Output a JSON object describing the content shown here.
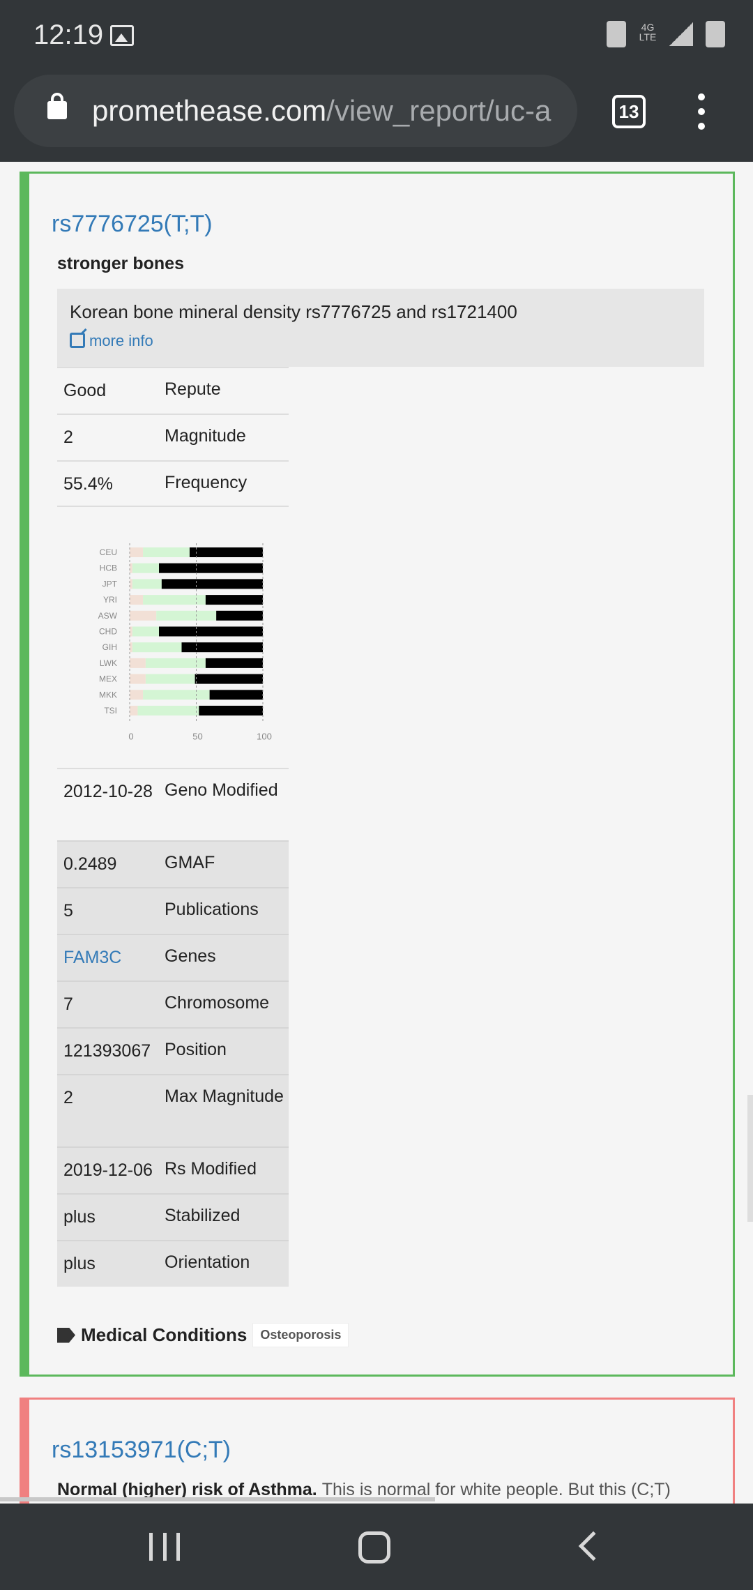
{
  "status_bar": {
    "time": "12:19",
    "network": "4G LTE"
  },
  "browser": {
    "url_host": "promethease.com",
    "url_path": "/view_report/uc-a",
    "tab_count": "13"
  },
  "card1": {
    "title": "rs7776725(T;T)",
    "summary": "stronger bones",
    "description": "Korean bone mineral density rs7776725 and rs1721400",
    "more_info": "more info",
    "facts_top": [
      {
        "value": "Good",
        "key": "Repute"
      },
      {
        "value": "2",
        "key": "Magnitude"
      },
      {
        "value": "55.4%",
        "key": "Frequency"
      }
    ],
    "facts_bottom": [
      {
        "value": "2012-10-28",
        "key": "Geno Modified"
      },
      {
        "value": "0.2489",
        "key": "GMAF"
      },
      {
        "value": "5",
        "key": "Publications"
      },
      {
        "value": "FAM3C",
        "key": "Genes"
      },
      {
        "value": "7",
        "key": "Chromosome"
      },
      {
        "value": "121393067",
        "key": "Position"
      },
      {
        "value": "2",
        "key": "Max Magnitude"
      },
      {
        "value": "2019-12-06",
        "key": "Rs Modified"
      },
      {
        "value": "plus",
        "key": "Stabilized"
      },
      {
        "value": "plus",
        "key": "Orientation"
      }
    ],
    "medical_conditions_label": "Medical Conditions",
    "medical_conditions": [
      "Osteoporosis"
    ]
  },
  "card2": {
    "title": "rs13153971(C;T)",
    "summary_bold": "Normal (higher) risk of Asthma.",
    "summary_rest": "This is normal for white people. But this (C;T)"
  },
  "colors": {
    "good": "#5cb85c",
    "bad": "#f08080",
    "link": "#337ab7",
    "c1": "#f2e0d6",
    "c2": "#d4f5d4",
    "c3": "#000000"
  },
  "chart_data": {
    "type": "bar",
    "stacked": true,
    "orientation": "horizontal",
    "categories": [
      "CEU",
      "HCB",
      "JPT",
      "YRI",
      "ASW",
      "CHD",
      "GIH",
      "LWK",
      "MEX",
      "MKK",
      "TSI"
    ],
    "series": [
      {
        "values": [
          10,
          2,
          2,
          10,
          20,
          2,
          2,
          12,
          12,
          10,
          6
        ]
      },
      {
        "values": [
          35,
          20,
          22,
          47,
          45,
          20,
          37,
          45,
          37,
          50,
          46
        ]
      },
      {
        "values": [
          55,
          78,
          76,
          43,
          35,
          78,
          61,
          43,
          51,
          40,
          48
        ]
      }
    ],
    "xlim": [
      0,
      100
    ],
    "xticks": [
      "0",
      "50",
      "100"
    ]
  }
}
